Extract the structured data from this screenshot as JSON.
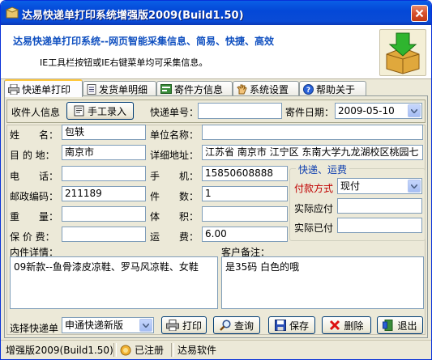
{
  "window": {
    "title": "达易快递单打印系统增强版2009(Build1.50)",
    "close_label": "✕"
  },
  "banner": {
    "title": "达易快递单打印系统--网页智能采集信息、简易、快捷、高效",
    "subtitle": "IE工具栏按钮或IE右键菜单均可采集信息。"
  },
  "tabs": [
    {
      "label": "快递单打印"
    },
    {
      "label": "发货单明细"
    },
    {
      "label": "寄件方信息"
    },
    {
      "label": "系统设置"
    },
    {
      "label": "帮助关于"
    }
  ],
  "toprow": {
    "recipient_label": "收件人信息",
    "manual_button": "手工录入",
    "tracking_label": "快递单号：",
    "tracking_value": "",
    "date_label": "寄件日期：",
    "date_value": "2009-05-10"
  },
  "form": {
    "name_label": "姓　　名：",
    "name_value": "包轶",
    "company_label": "单位名称：",
    "company_value": "",
    "destination_label": "目 的 地：",
    "destination_value": "南京市",
    "address_label": "详细地址：",
    "address_value": "江苏省 南京市 江宁区 东南大学九龙湖校区桃园七",
    "phone_label": "电　　话：",
    "phone_value": "",
    "mobile_label": "手　　机：",
    "mobile_value": "15850608888",
    "postcode_label": "邮政编码：",
    "postcode_value": "211189",
    "pieces_label": "件　　数：",
    "pieces_value": "1",
    "weight_label": "重　　量：",
    "weight_value": "",
    "volume_label": "体　　积：",
    "volume_value": "",
    "insurance_label": "保 价 费：",
    "insurance_value": "",
    "freight_label": "运　　费：",
    "freight_value": "6.00"
  },
  "shipping": {
    "legend": "快递、运费",
    "payment_label": "付款方式",
    "payment_value": "现付",
    "payable_label": "实际应付",
    "payable_value": "",
    "paid_label": "实际已付",
    "paid_value": ""
  },
  "notes": {
    "items_label": "内件详情：",
    "items_value": "09新款--鱼骨漆皮凉鞋、罗马风凉鞋、女鞋",
    "remarks_label": "客户备注：",
    "remarks_value": "是35码 白色的哦"
  },
  "actions": {
    "courier_label": "选择快递单",
    "courier_value": "申通快递新版",
    "print": "打印",
    "query": "查询",
    "save": "保存",
    "delete": "删除",
    "exit": "退出"
  },
  "status": {
    "version": "增强版2009(Build1.50)",
    "registered": "已注册",
    "vendor": "达易软件"
  },
  "colors": {
    "title_blue": "#0a50d8",
    "banner_title": "#1050c0",
    "payment_label": "#c00000",
    "group_legend": "#1040b0"
  }
}
